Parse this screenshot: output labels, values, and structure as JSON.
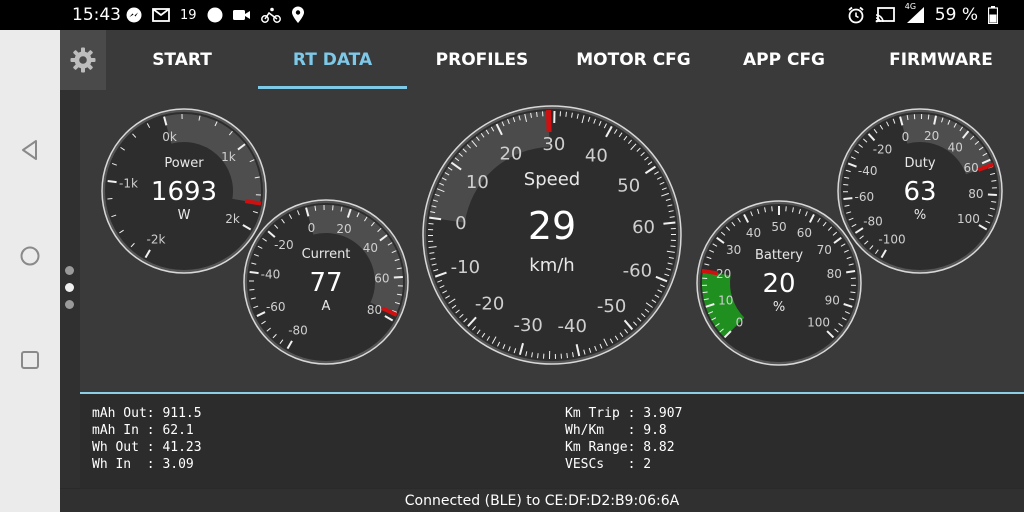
{
  "status_bar": {
    "time": "15:43",
    "notification_count": "19",
    "battery": "59 %",
    "network": "4G"
  },
  "tabs": [
    {
      "label": "START",
      "active": false
    },
    {
      "label": "RT DATA",
      "active": true
    },
    {
      "label": "PROFILES",
      "active": false
    },
    {
      "label": "MOTOR CFG",
      "active": false
    },
    {
      "label": "APP CFG",
      "active": false
    },
    {
      "label": "FIRMWARE",
      "active": false
    }
  ],
  "gauges": {
    "power": {
      "title": "Power",
      "value": "1693",
      "unit": "W",
      "min": -2000,
      "max": 2000,
      "current": 1693,
      "labels": [
        "-2k",
        "-1k",
        "0k",
        "1k",
        "2k"
      ]
    },
    "current": {
      "title": "Current",
      "value": "77",
      "unit": "A",
      "min": -80,
      "max": 80,
      "current": 77,
      "labels": [
        "-80",
        "-60",
        "-40",
        "-20",
        "0",
        "20",
        "40",
        "60",
        "80"
      ]
    },
    "speed": {
      "title": "Speed",
      "value": "29",
      "unit": "km/h",
      "current": 29,
      "labels": [
        "-30",
        "-20",
        "-10",
        "0",
        "10",
        "20",
        "30",
        "40",
        "50",
        "60",
        "-60",
        "-50",
        "-40"
      ]
    },
    "battery": {
      "title": "Battery",
      "value": "20",
      "unit": "%",
      "min": 0,
      "max": 100,
      "current": 20,
      "labels": [
        "0",
        "10",
        "20",
        "30",
        "40",
        "50",
        "60",
        "70",
        "80",
        "90",
        "100"
      ]
    },
    "duty": {
      "title": "Duty",
      "value": "63",
      "unit": "%",
      "min": -100,
      "max": 100,
      "current": 63,
      "labels": [
        "-100",
        "-80",
        "-60",
        "-40",
        "-20",
        "0",
        "20",
        "40",
        "60",
        "80",
        "100"
      ]
    }
  },
  "stats_left": [
    "mAh Out: 911.5",
    "mAh In : 62.1",
    "Wh Out : 41.23",
    "Wh In  : 3.09"
  ],
  "stats_right": [
    "Km Trip : 3.907",
    "Wh/Km   : 9.8",
    "Km Range: 8.82",
    "VESCs   : 2"
  ],
  "footer": {
    "connection": "Connected (BLE) to CE:DF:D2:B9:06:6A"
  },
  "colors": {
    "accent": "#7ec8e8",
    "needle": "#d01010",
    "battery_fill": "#1e9a1e"
  }
}
